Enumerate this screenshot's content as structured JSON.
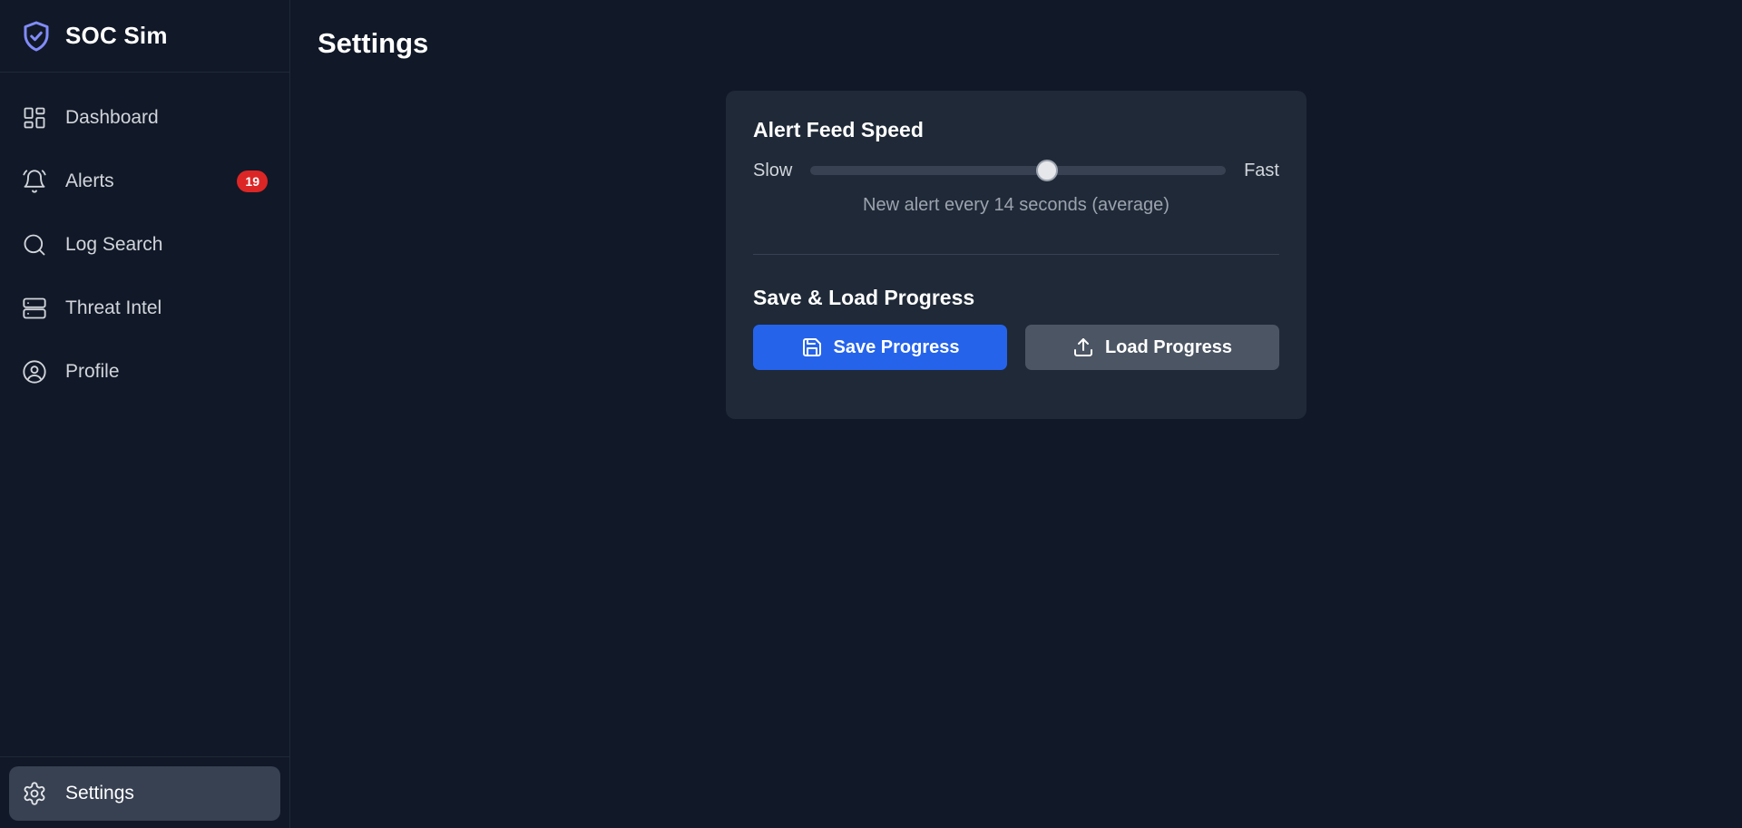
{
  "app": {
    "name": "SOC Sim",
    "accent": "#818cf8"
  },
  "sidebar": {
    "items": [
      {
        "label": "Dashboard",
        "icon": "dashboard-icon"
      },
      {
        "label": "Alerts",
        "icon": "bell-icon",
        "badge": "19"
      },
      {
        "label": "Log Search",
        "icon": "search-icon"
      },
      {
        "label": "Threat Intel",
        "icon": "server-icon"
      },
      {
        "label": "Profile",
        "icon": "user-circle-icon"
      }
    ],
    "settings": {
      "label": "Settings",
      "icon": "gear-icon",
      "active": true
    }
  },
  "page": {
    "title": "Settings"
  },
  "speed": {
    "heading": "Alert Feed Speed",
    "min_label": "Slow",
    "max_label": "Fast",
    "level": 0.57,
    "caption": "New alert every 14 seconds (average)"
  },
  "progress": {
    "heading": "Save & Load Progress",
    "save_label": "Save Progress",
    "save_color": "#2563eb",
    "load_label": "Load Progress",
    "load_color": "#4b5563"
  }
}
